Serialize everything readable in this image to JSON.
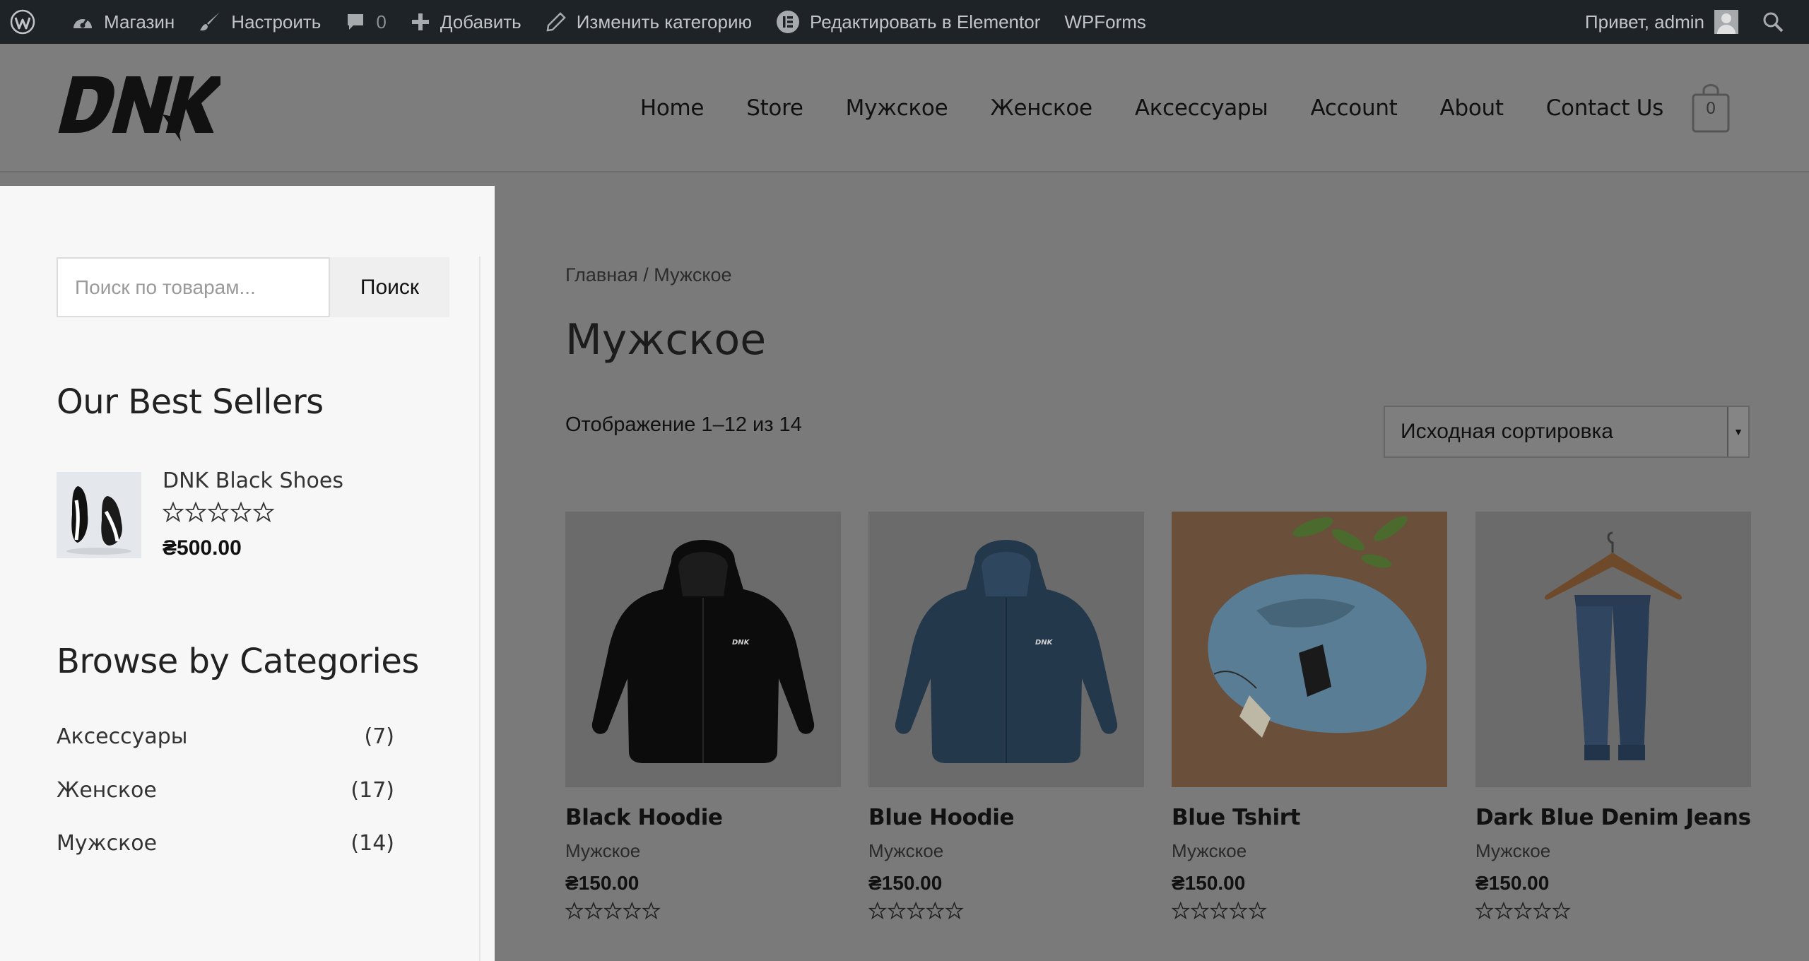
{
  "adminbar": {
    "shop": "Магазин",
    "customize": "Настроить",
    "comments_count": "0",
    "add_new": "Добавить",
    "edit_category": "Изменить категорию",
    "edit_elementor": "Редактировать в Elementor",
    "wpforms": "WPForms",
    "greeting": "Привет, admin"
  },
  "header": {
    "nav": [
      "Home",
      "Store",
      "Мужское",
      "Женское",
      "Аксессуары",
      "Account",
      "About",
      "Contact Us"
    ],
    "cart_count": "0"
  },
  "sidebar": {
    "search_placeholder": "Поиск по товарам...",
    "search_button": "Поиск",
    "best_sellers_title": "Our Best Sellers",
    "best_seller": {
      "name": "DNK Black Shoes",
      "price": "₴500.00",
      "rating": 0
    },
    "categories_title": "Browse by Categories",
    "categories": [
      {
        "name": "Аксессуары",
        "count": "(7)"
      },
      {
        "name": "Женское",
        "count": "(17)"
      },
      {
        "name": "Мужское",
        "count": "(14)"
      }
    ]
  },
  "main": {
    "breadcrumb": "Главная / Мужское",
    "title": "Мужское",
    "result_count": "Отображение 1–12 из 14",
    "orderby": "Исходная сортировка",
    "products": [
      {
        "name": "Black Hoodie",
        "category": "Мужское",
        "price": "₴150.00",
        "rating": 0
      },
      {
        "name": "Blue Hoodie",
        "category": "Мужское",
        "price": "₴150.00",
        "rating": 0
      },
      {
        "name": "Blue Tshirt",
        "category": "Мужское",
        "price": "₴150.00",
        "rating": 0
      },
      {
        "name": "Dark Blue Denim Jeans",
        "category": "Мужское",
        "price": "₴150.00",
        "rating": 0
      }
    ]
  },
  "colors": {
    "adminbar_bg": "#1d2327",
    "overlay": "#7a7a7a",
    "sidebar_bg": "#f7f7f7"
  }
}
